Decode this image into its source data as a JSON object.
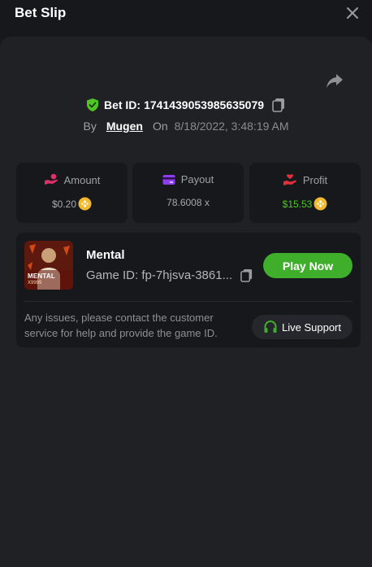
{
  "header": {
    "title": "Bet Slip"
  },
  "bet": {
    "id_label": "Bet ID:",
    "id_value": "1741439053985635079",
    "by_label": "By",
    "user": "Mugen",
    "on_label": "On",
    "datetime": "8/18/2022, 3:48:19 AM"
  },
  "stats": {
    "amount": {
      "label": "Amount",
      "value": "$0.20"
    },
    "payout": {
      "label": "Payout",
      "value": "78.6008 x"
    },
    "profit": {
      "label": "Profit",
      "value": "$15.53"
    }
  },
  "game": {
    "name": "Mental",
    "id_text": "Game ID: fp-7hjsva-3861...",
    "thumb_title": "MENTAL",
    "thumb_sub": "X9999",
    "play_label": "Play Now"
  },
  "support": {
    "text": "Any issues, please contact the customer service for help and provide the game ID.",
    "button_label": "Live Support"
  },
  "colors": {
    "accent_green": "#3fae2a",
    "profit_green": "#4fc625",
    "coin_gold": "#f3ba2f",
    "amount_icon": "#e0306a",
    "payout_icon": "#8d3cf0",
    "profit_icon": "#e0303a",
    "shield_green": "#4fc625"
  },
  "icons": {
    "close": "close-icon",
    "share": "share-icon",
    "shield": "shield-check-icon",
    "copy": "copy-icon",
    "amount": "hand-coin-icon",
    "payout": "card-icon",
    "profit": "hand-heart-icon",
    "coin": "bnb-coin-icon",
    "support": "headphones-icon"
  }
}
